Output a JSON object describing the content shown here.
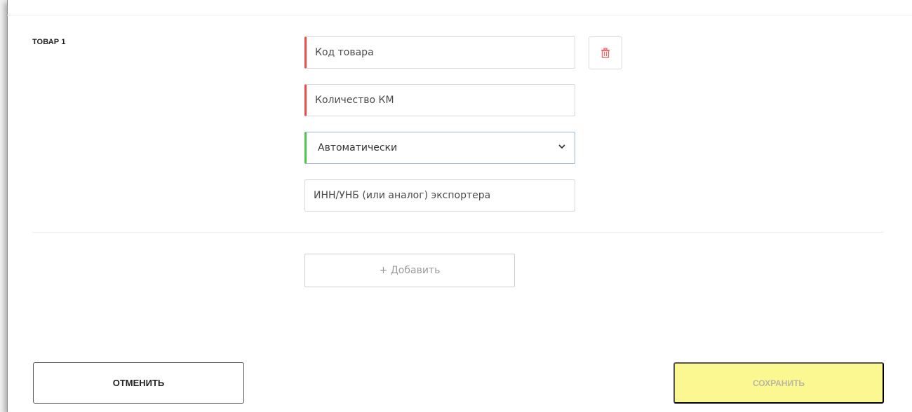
{
  "section": {
    "label": "ТОВАР 1"
  },
  "form": {
    "product_code": {
      "value": "",
      "placeholder": "Код товара"
    },
    "km_quantity": {
      "value": "",
      "placeholder": "Количество КМ"
    },
    "mode_select": {
      "selected": "Автоматически"
    },
    "exporter_inn": {
      "value": "",
      "placeholder": "ИНН/УНБ (или аналог) экспортера"
    }
  },
  "actions": {
    "add_label": "+ Добавить",
    "cancel_label": "ОТМЕНИТЬ",
    "save_label": "СОХРАНИТЬ"
  },
  "icons": {
    "delete": "trash-icon",
    "select_toggle": "chevron-down-icon"
  },
  "colors": {
    "error": "#ee4b4b",
    "valid": "#4cc84c",
    "save_bg": "#fbf892",
    "save_text": "#b9b7a0",
    "trash": "#ee6b6b"
  }
}
